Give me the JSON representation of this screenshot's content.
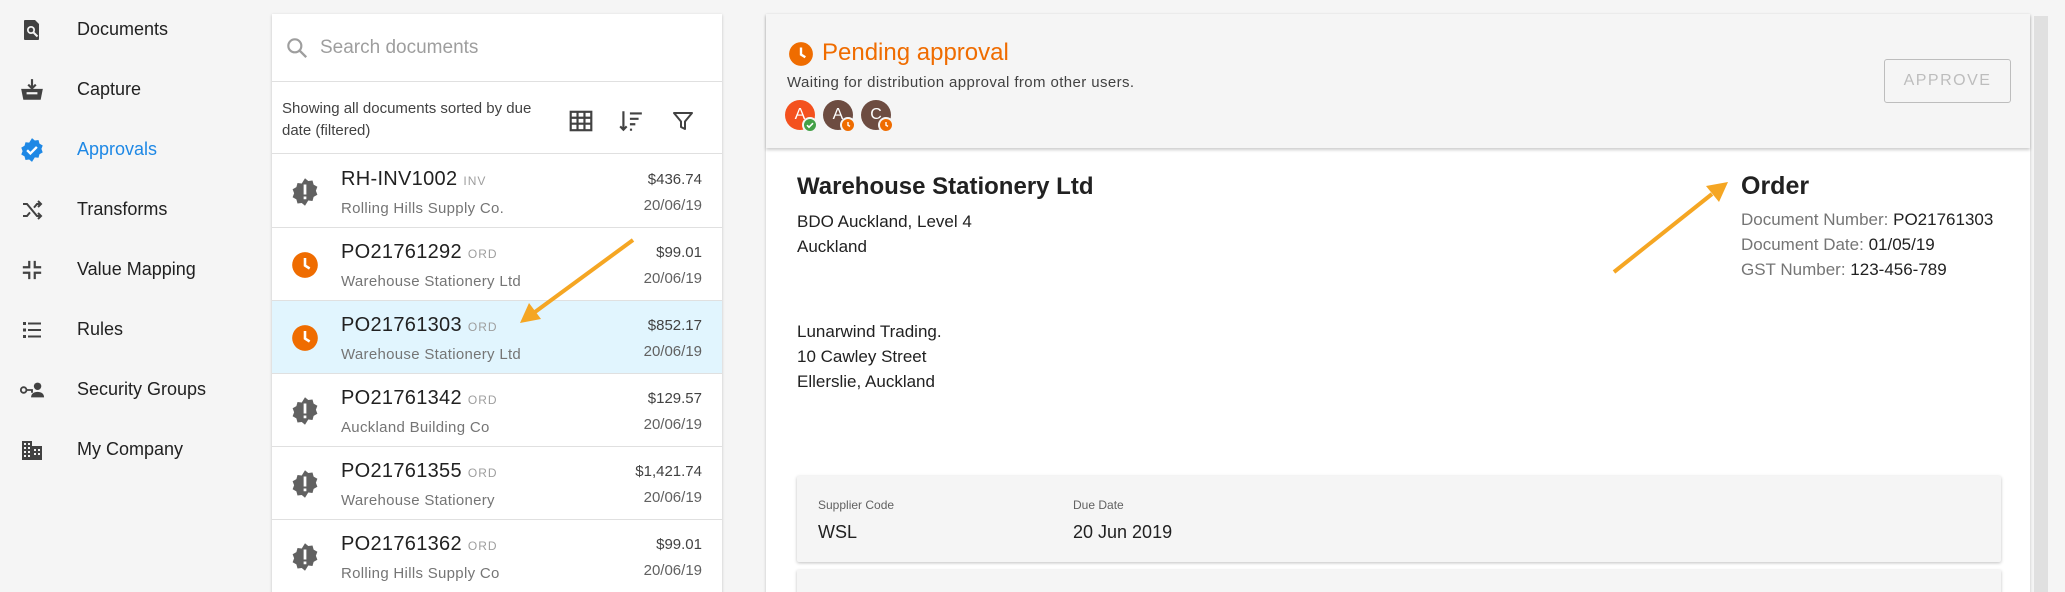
{
  "sidebar": {
    "items": [
      {
        "label": "Documents",
        "icon": "document-search-icon"
      },
      {
        "label": "Capture",
        "icon": "capture-tray-icon"
      },
      {
        "label": "Approvals",
        "icon": "verified-badge-icon",
        "active": true
      },
      {
        "label": "Transforms",
        "icon": "shuffle-icon"
      },
      {
        "label": "Value Mapping",
        "icon": "collapse-arrows-icon"
      },
      {
        "label": "Rules",
        "icon": "list-icon"
      },
      {
        "label": "Security Groups",
        "icon": "user-key-icon"
      },
      {
        "label": "My Company",
        "icon": "building-icon"
      }
    ]
  },
  "search": {
    "placeholder": "Search documents"
  },
  "list": {
    "status": "Showing all documents sorted by due date (filtered)",
    "documents": [
      {
        "number": "RH-INV1002",
        "type": "INV",
        "supplier": "Rolling Hills Supply Co.",
        "amount": "$436.74",
        "date": "20/06/19",
        "status_icon": "alert-icon"
      },
      {
        "number": "PO21761292",
        "type": "ORD",
        "supplier": "Warehouse Stationery Ltd",
        "amount": "$99.01",
        "date": "20/06/19",
        "status_icon": "clock-icon"
      },
      {
        "number": "PO21761303",
        "type": "ORD",
        "supplier": "Warehouse Stationery Ltd",
        "amount": "$852.17",
        "date": "20/06/19",
        "status_icon": "clock-icon",
        "selected": true
      },
      {
        "number": "PO21761342",
        "type": "ORD",
        "supplier": "Auckland Building Co",
        "amount": "$129.57",
        "date": "20/06/19",
        "status_icon": "alert-icon"
      },
      {
        "number": "PO21761355",
        "type": "ORD",
        "supplier": "Warehouse Stationery",
        "amount": "$1,421.74",
        "date": "20/06/19",
        "status_icon": "alert-icon"
      },
      {
        "number": "PO21761362",
        "type": "ORD",
        "supplier": "Rolling Hills Supply Co",
        "amount": "$99.01",
        "date": "20/06/19",
        "status_icon": "alert-icon"
      }
    ]
  },
  "approval": {
    "title": "Pending approval",
    "subtitle": "Waiting for distribution approval from other users.",
    "button": "APPROVE",
    "approvers": [
      {
        "initial": "A",
        "color": "#f4511e",
        "badge": "check-icon",
        "badge_color": "#43a047"
      },
      {
        "initial": "A",
        "color": "#6d4c41",
        "badge": "clock-icon",
        "badge_color": "#ef6c00"
      },
      {
        "initial": "C",
        "color": "#6d4c41",
        "badge": "clock-icon",
        "badge_color": "#ef6c00"
      }
    ]
  },
  "document": {
    "supplier_name": "Warehouse Stationery Ltd",
    "supplier_address": [
      "BDO Auckland, Level 4",
      "Auckland"
    ],
    "buyer_address": [
      "Lunarwind Trading.",
      "10 Cawley Street",
      "Ellerslie, Auckland"
    ],
    "heading": "Order",
    "meta": [
      {
        "label": "Document Number:",
        "value": "PO21761303"
      },
      {
        "label": "Document Date:",
        "value": "01/05/19"
      },
      {
        "label": "GST Number:",
        "value": "123-456-789"
      }
    ],
    "fields": [
      {
        "label": "Supplier Code",
        "value": "WSL"
      },
      {
        "label": "Due Date",
        "value": "20 Jun 2019"
      }
    ]
  },
  "colors": {
    "accent": "#1e88e5",
    "pending": "#ef6c00",
    "alert": "#616161",
    "selected_row": "#e1f5fe",
    "arrow": "#f5a623"
  }
}
